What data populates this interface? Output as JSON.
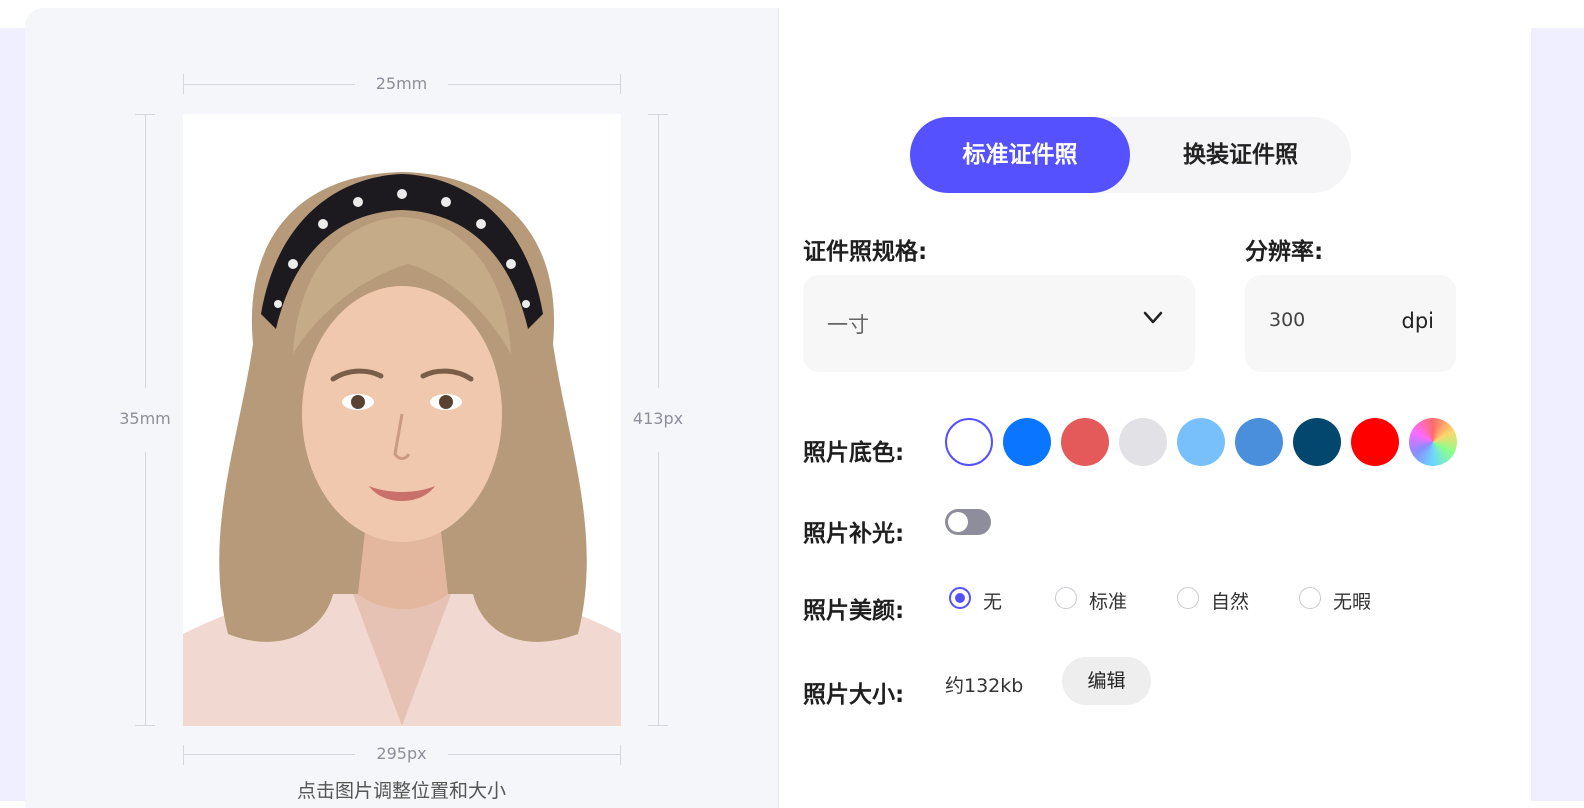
{
  "preview": {
    "width_mm": "25mm",
    "height_mm": "35mm",
    "width_px": "295px",
    "height_px": "413px",
    "hint": "点击图片调整位置和大小"
  },
  "mode_tabs": [
    {
      "label": "标准证件照",
      "active": true
    },
    {
      "label": "换装证件照",
      "active": false
    }
  ],
  "spec": {
    "label": "证件照规格:",
    "value": "一寸"
  },
  "resolution": {
    "label": "分辨率:",
    "value": "300",
    "unit": "dpi"
  },
  "background": {
    "label": "照片底色:",
    "colors": [
      "#ffffff",
      "#0a76ff",
      "#e45a5a",
      "#e1e1e6",
      "#78c0fb",
      "#4a8fdc",
      "#03476e",
      "#ff0000",
      "rainbow"
    ],
    "selected_index": 0,
    "accent": "#5551ff"
  },
  "fill_light": {
    "label": "照片补光:",
    "on": false
  },
  "beauty": {
    "label": "照片美颜:",
    "options": [
      "无",
      "标准",
      "自然",
      "无暇"
    ],
    "selected_index": 0
  },
  "size": {
    "label": "照片大小:",
    "value": "约132kb",
    "edit_label": "编辑"
  }
}
